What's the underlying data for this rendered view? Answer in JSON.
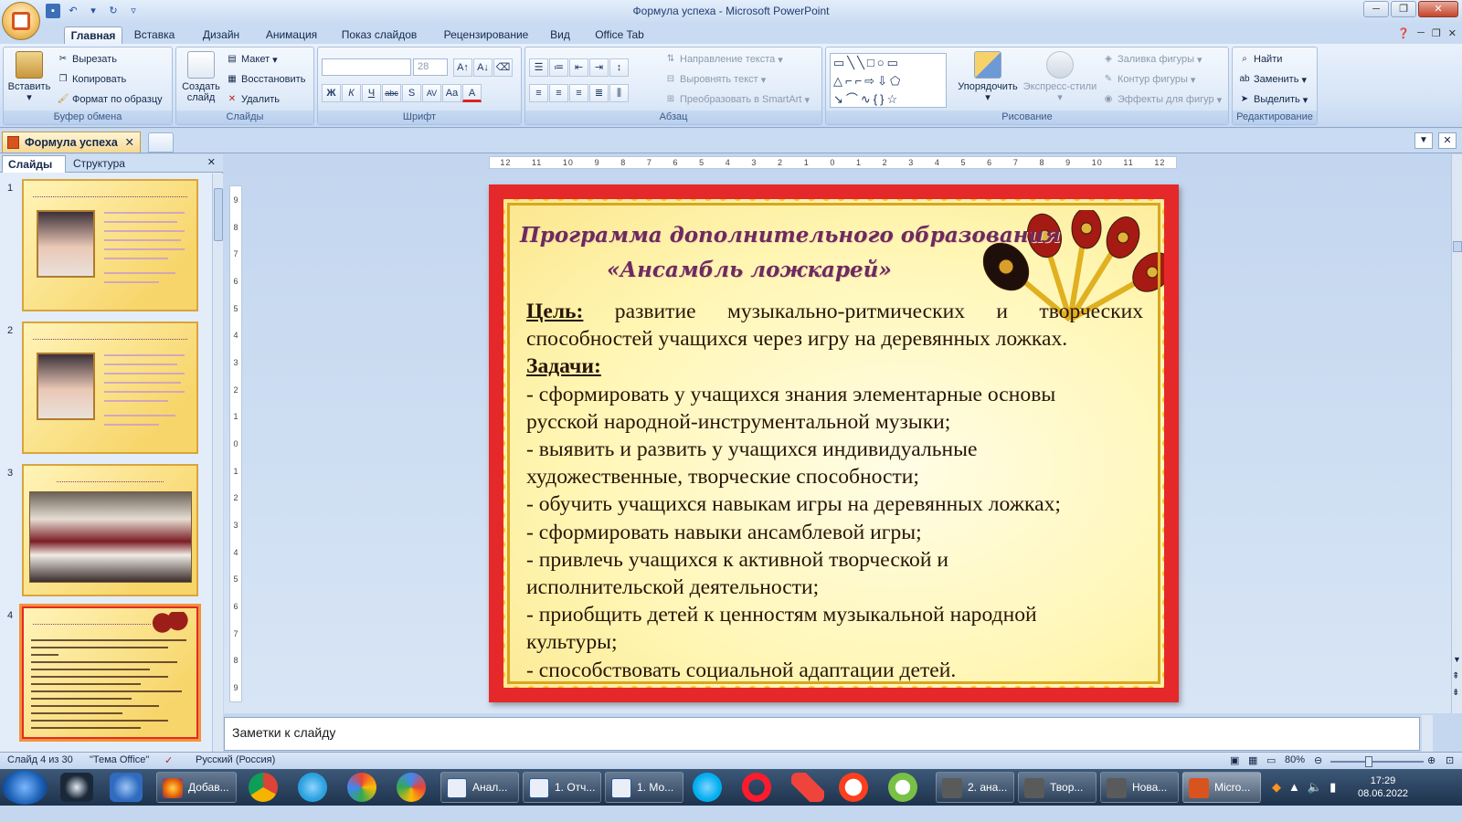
{
  "window": {
    "title": "Формула успеха - Microsoft PowerPoint"
  },
  "ribbon_tabs": [
    "Главная",
    "Вставка",
    "Дизайн",
    "Анимация",
    "Показ слайдов",
    "Рецензирование",
    "Вид",
    "Office Tab"
  ],
  "ribbon": {
    "clipboard": {
      "paste": "Вставить",
      "cut": "Вырезать",
      "copy": "Копировать",
      "format_painter": "Формат по образцу",
      "title": "Буфер обмена"
    },
    "slides": {
      "new_slide_1": "Создать",
      "new_slide_2": "слайд",
      "layout": "Макет",
      "reset": "Восстановить",
      "delete": "Удалить",
      "title": "Слайды"
    },
    "font": {
      "font_name": "",
      "font_size": "28",
      "title": "Шрифт",
      "bold": "Ж",
      "italic": "К",
      "underline": "Ч",
      "strike": "abc",
      "shadow": "S",
      "spacing": "AV",
      "case": "Aa",
      "color": "A"
    },
    "paragraph": {
      "text_direction": "Направление текста",
      "align_text": "Выровнять текст",
      "smartart": "Преобразовать в SmartArt",
      "title": "Абзац"
    },
    "drawing": {
      "arrange": "Упорядочить",
      "quick_styles": "Экспресс-стили",
      "fill": "Заливка фигуры",
      "outline": "Контур фигуры",
      "effects": "Эффекты для фигур",
      "title": "Рисование"
    },
    "editing": {
      "find": "Найти",
      "replace": "Заменить",
      "select": "Выделить",
      "title": "Редактирование"
    }
  },
  "doc_tab": "Формула успеха",
  "left_pane": {
    "tab_slides": "Слайды",
    "tab_outline": "Структура",
    "thumbnails": [
      {
        "num": "1"
      },
      {
        "num": "2"
      },
      {
        "num": "3"
      },
      {
        "num": "4"
      }
    ]
  },
  "ruler": {
    "h_ticks": [
      "12",
      "11",
      "10",
      "9",
      "8",
      "7",
      "6",
      "5",
      "4",
      "3",
      "2",
      "1",
      "0",
      "1",
      "2",
      "3",
      "4",
      "5",
      "6",
      "7",
      "8",
      "9",
      "10",
      "11",
      "12"
    ],
    "v_ticks": [
      "9",
      "8",
      "7",
      "6",
      "5",
      "4",
      "3",
      "2",
      "1",
      "0",
      "1",
      "2",
      "3",
      "4",
      "5",
      "6",
      "7",
      "8",
      "9"
    ]
  },
  "slide": {
    "title": "Программа дополнительного образования",
    "subtitle": "«Ансамбль  ложкарей»",
    "goal_label": "Цель:",
    "goal_text_1": "развитие музыкально-ритмических и творческих",
    "goal_text_2": "способностей учащихся через игру на деревянных ложках.",
    "tasks_label": "Задачи:",
    "tasks": [
      "- сформировать у учащихся знания элементарные основы",
      "русской  народной-инструментальной музыки;",
      "- выявить и развить у учащихся индивидуальные",
      "художественные, творческие способности;",
      "- обучить учащихся навыкам игры на деревянных ложках;",
      "- сформировать навыки ансамблевой игры;",
      "- привлечь учащихся к активной творческой и",
      "исполнительской деятельности;",
      "- приобщить детей к ценностям музыкальной народной",
      "культуры;",
      "- способствовать социальной адаптации детей."
    ]
  },
  "notes_placeholder": "Заметки к слайду",
  "status": {
    "slide_counter": "Слайд 4 из 30",
    "theme": "\"Тема Office\"",
    "language": "Русский (Россия)",
    "zoom": "80%"
  },
  "taskbar": {
    "apps": [
      "Добав...",
      "Анал...",
      "1. Отч...",
      "1. Мо...",
      "2. ана...",
      "Твор...",
      "Нова...",
      "Micro..."
    ],
    "time": "17:29",
    "date": "08.06.2022"
  }
}
